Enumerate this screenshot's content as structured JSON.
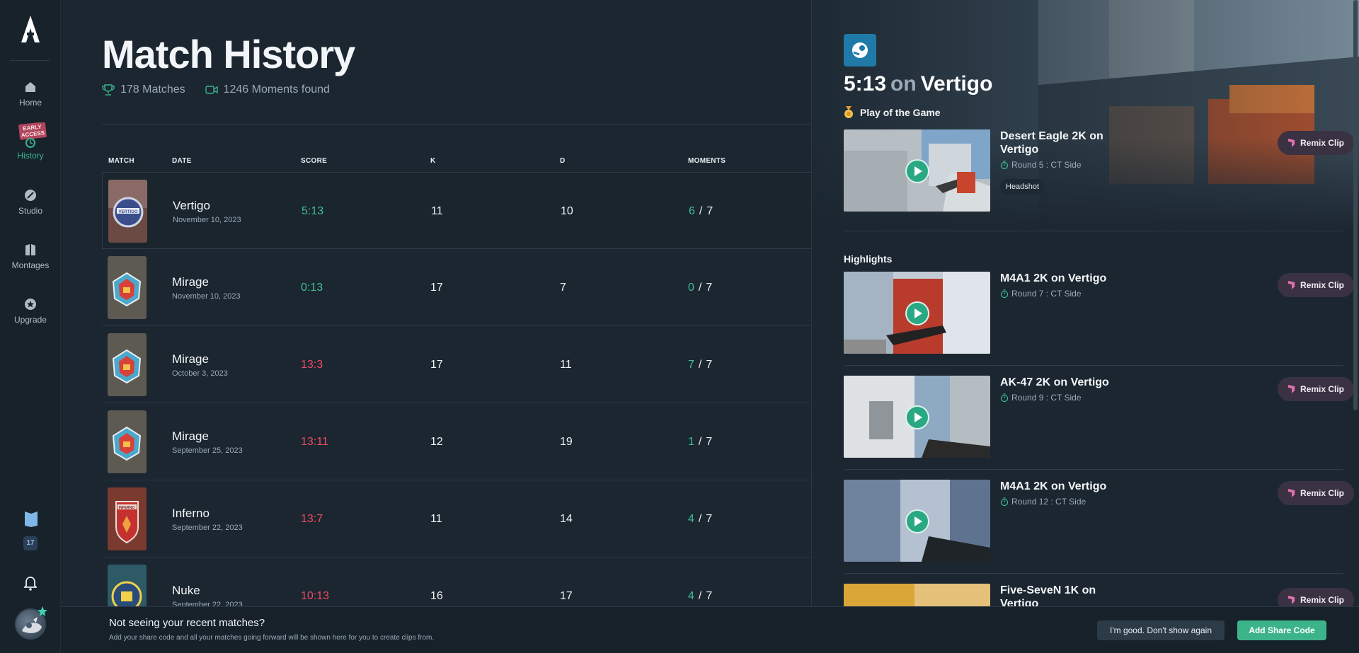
{
  "app": {
    "brand_color": "#39b38c",
    "loss_color": "#ef4a64"
  },
  "sidebar": {
    "items": [
      {
        "label": "Home",
        "icon": "home-icon"
      },
      {
        "label": "History",
        "icon": "history-icon",
        "badge": "EARLY ACCESS"
      },
      {
        "label": "Studio",
        "icon": "studio-icon"
      },
      {
        "label": "Montages",
        "icon": "montages-icon"
      },
      {
        "label": "Upgrade",
        "icon": "star-icon"
      }
    ],
    "count": "17"
  },
  "header": {
    "title": "Match History",
    "matches": "178 Matches",
    "moments": "1246 Moments found"
  },
  "table": {
    "columns": [
      "MATCH",
      "DATE",
      "SCORE",
      "K",
      "D",
      "MOMENTS"
    ],
    "rows": [
      {
        "map": "Vertigo",
        "date": "November 10, 2023",
        "score": "5:13",
        "result": "win",
        "k": "11",
        "d": "10",
        "moments": "6",
        "total": "7"
      },
      {
        "map": "Mirage",
        "date": "November 10, 2023",
        "score": "0:13",
        "result": "win",
        "k": "17",
        "d": "7",
        "moments": "0",
        "total": "7"
      },
      {
        "map": "Mirage",
        "date": "October 3, 2023",
        "score": "13:3",
        "result": "loss",
        "k": "17",
        "d": "11",
        "moments": "7",
        "total": "7"
      },
      {
        "map": "Mirage",
        "date": "September 25, 2023",
        "score": "13:11",
        "result": "loss",
        "k": "12",
        "d": "19",
        "moments": "1",
        "total": "7"
      },
      {
        "map": "Inferno",
        "date": "September 22, 2023",
        "score": "13:7",
        "result": "loss",
        "k": "11",
        "d": "14",
        "moments": "4",
        "total": "7"
      },
      {
        "map": "Nuke",
        "date": "September 22, 2023",
        "score": "10:13",
        "result": "loss",
        "k": "16",
        "d": "17",
        "moments": "4",
        "total": "7"
      }
    ]
  },
  "panel": {
    "score": "5:13",
    "on": "on",
    "map": "Vertigo",
    "potg_label": "Play of the Game",
    "potg": {
      "title": "Desert Eagle 2K on Vertigo",
      "round": "Round 5 : CT Side",
      "tag": "Headshot"
    },
    "highlights_label": "Highlights",
    "remix_label": "Remix Clip",
    "clips": [
      {
        "title": "M4A1 2K on Vertigo",
        "round": "Round 7 : CT Side"
      },
      {
        "title": "AK-47 2K on Vertigo",
        "round": "Round 9 : CT Side"
      },
      {
        "title": "M4A1 2K on Vertigo",
        "round": "Round 12 : CT Side"
      },
      {
        "title": "Five-SeveN 1K on Vertigo",
        "round": ""
      }
    ]
  },
  "banner": {
    "title": "Not seeing your recent matches?",
    "subtitle": "Add your share code and all your matches going forward will be shown here for you to create clips from.",
    "dismiss_label": "I'm good. Don't show again",
    "add_label": "Add Share Code"
  }
}
